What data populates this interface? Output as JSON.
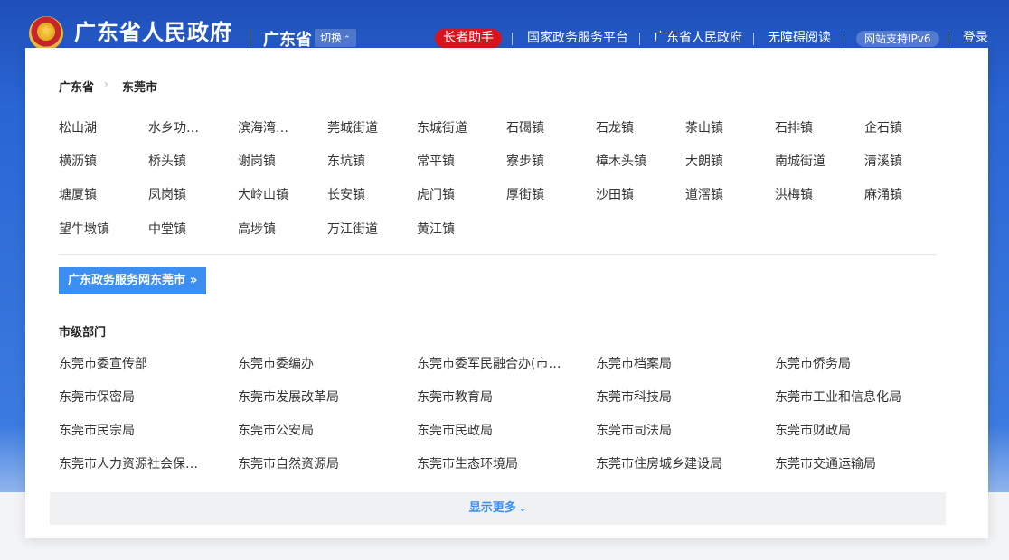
{
  "header": {
    "site_title": "广东省人民政府",
    "region_name": "广东省",
    "switch_label": "切换",
    "elder_assistant": "长者助手",
    "nav": [
      "国家政务服务平台",
      "广东省人民政府",
      "无障碍阅读"
    ],
    "ipv6_badge": "网站支持IPv6",
    "login": "登录"
  },
  "panel": {
    "breadcrumb": {
      "level1": "广东省",
      "level2": "东莞市"
    },
    "towns": [
      "松山湖",
      "水乡功…",
      "滨海湾…",
      "莞城街道",
      "东城街道",
      "石碣镇",
      "石龙镇",
      "茶山镇",
      "石排镇",
      "企石镇",
      "横沥镇",
      "桥头镇",
      "谢岗镇",
      "东坑镇",
      "常平镇",
      "寮步镇",
      "樟木头镇",
      "大朗镇",
      "南城街道",
      "清溪镇",
      "塘厦镇",
      "凤岗镇",
      "大岭山镇",
      "长安镇",
      "虎门镇",
      "厚街镇",
      "沙田镇",
      "道滘镇",
      "洪梅镇",
      "麻涌镇",
      "望牛墩镇",
      "中堂镇",
      "高埗镇",
      "万江街道",
      "黄江镇"
    ],
    "portal_button": "广东政务服务网东莞市",
    "section_title": "市级部门",
    "departments": [
      "东莞市委宣传部",
      "东莞市委编办",
      "东莞市委军民融合办(市…",
      "东莞市档案局",
      "东莞市侨务局",
      "东莞市保密局",
      "东莞市发展改革局",
      "东莞市教育局",
      "东莞市科技局",
      "东莞市工业和信息化局",
      "东莞市民宗局",
      "东莞市公安局",
      "东莞市民政局",
      "东莞市司法局",
      "东莞市财政局",
      "东莞市人力资源社会保障局",
      "东莞市自然资源局",
      "东莞市生态环境局",
      "东莞市住房城乡建设局",
      "东莞市交通运输局"
    ],
    "show_more": "显示更多"
  },
  "colors": {
    "header_blue": "#2a66d4",
    "accent_blue": "#3c8ef0",
    "elder_red": "#d9141e"
  }
}
